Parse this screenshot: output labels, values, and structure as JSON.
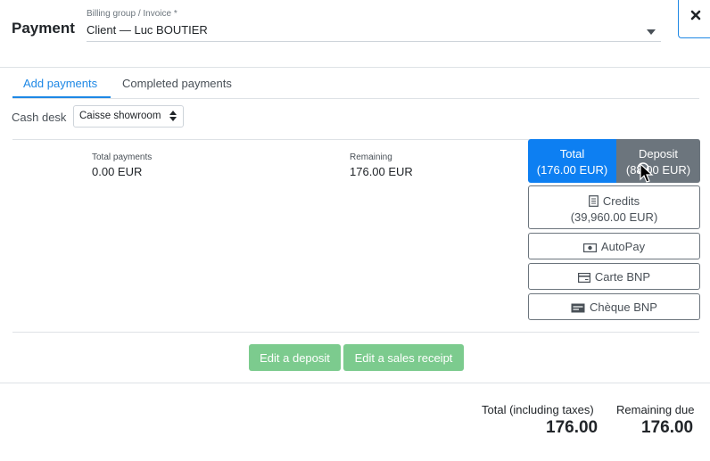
{
  "header": {
    "title": "Payment",
    "billing_label": "Billing group / Invoice *",
    "billing_value": "Client — Luc BOUTIER"
  },
  "tabs": [
    {
      "label": "Add payments",
      "active": true
    },
    {
      "label": "Completed payments",
      "active": false
    }
  ],
  "cash_desk": {
    "label": "Cash desk",
    "value": "Caisse showroom"
  },
  "summary": {
    "total_payments_label": "Total payments",
    "total_payments_value": "0.00 EUR",
    "remaining_label": "Remaining",
    "remaining_value": "176.00 EUR"
  },
  "payment_buttons": {
    "total_label": "Total",
    "total_amount": "(176.00 EUR)",
    "deposit_label": "Deposit",
    "deposit_amount": "(88.00 EUR)",
    "credits_label": "Credits",
    "credits_amount": "(39,960.00 EUR)",
    "autopay_label": "AutoPay",
    "carte_label": "Carte BNP",
    "cheque_label": "Chèque BNP"
  },
  "actions": {
    "edit_deposit": "Edit a deposit",
    "edit_receipt": "Edit a sales receipt"
  },
  "footer": {
    "total_label": "Total (including taxes)",
    "total_value": "176.00",
    "remaining_label": "Remaining due",
    "remaining_value": "176.00"
  },
  "colors": {
    "primary": "#0d7ff2",
    "secondary": "#6c757d",
    "success_disabled": "#7ccb8e",
    "tab_active": "#1e88e5"
  },
  "icons": {
    "close": "close-icon",
    "credits": "receipt-icon",
    "autopay": "banknote-icon",
    "carte": "credit-card-icon",
    "cheque": "cheque-icon"
  }
}
